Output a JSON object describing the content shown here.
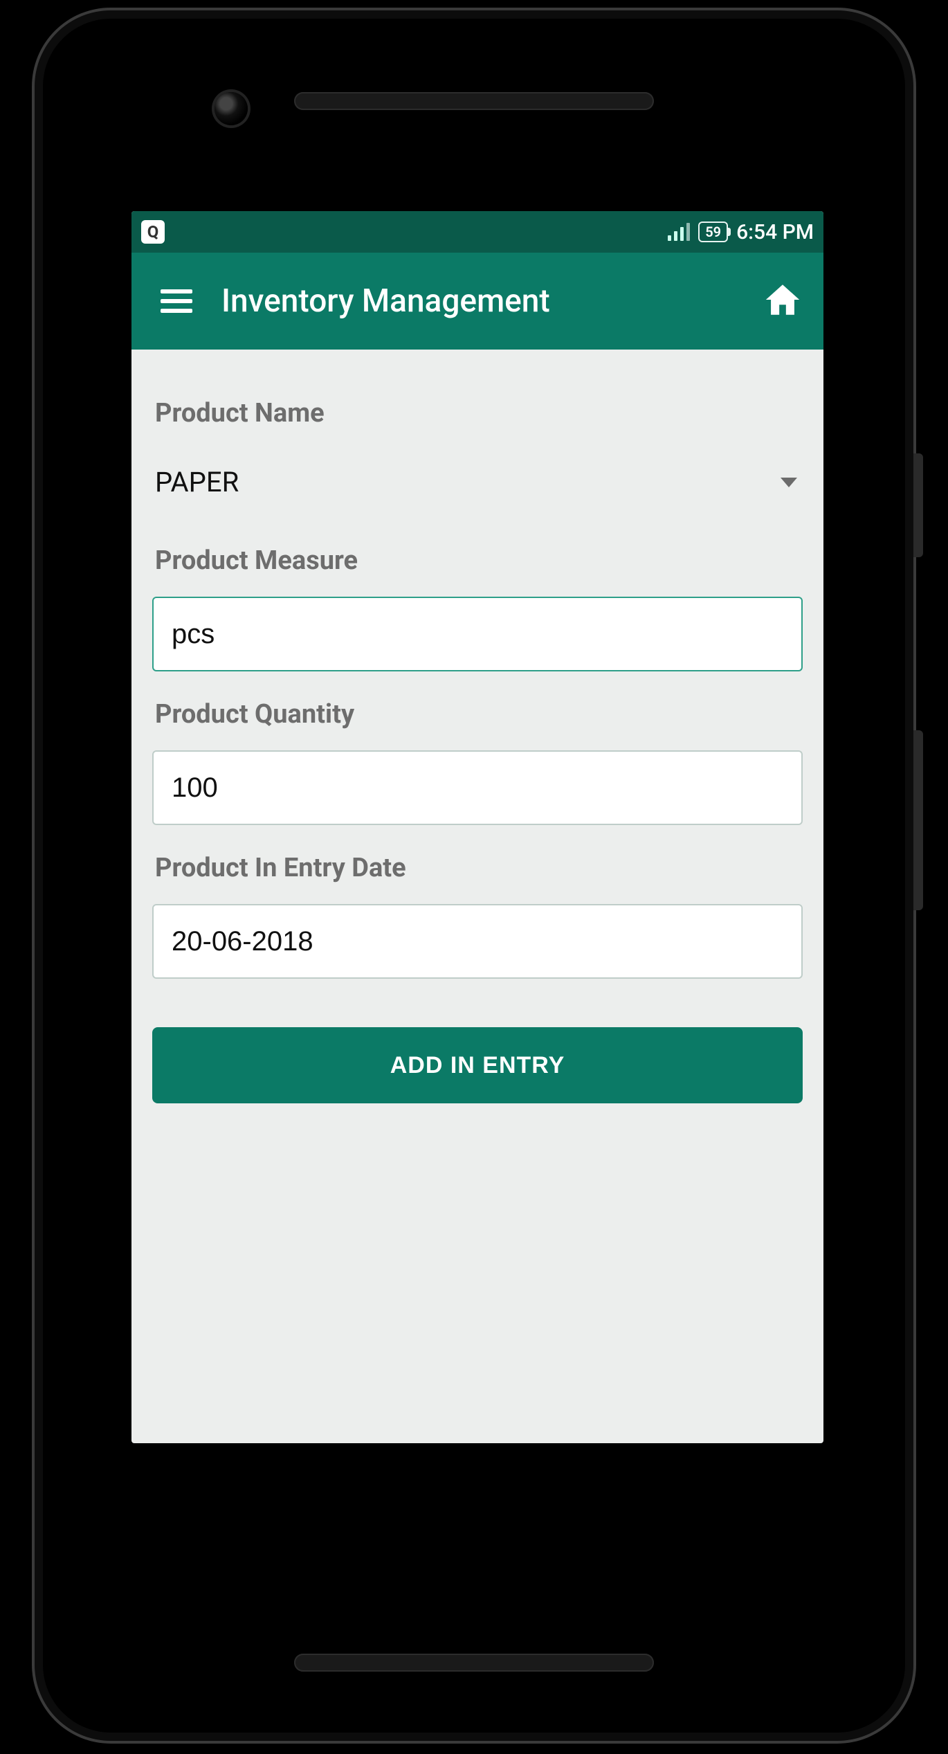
{
  "statusbar": {
    "notification_icon_label": "Q",
    "battery_pct": "59",
    "clock": "6:54 PM"
  },
  "appbar": {
    "title": "Inventory Management"
  },
  "form": {
    "product_name": {
      "label": "Product Name",
      "value": "PAPER"
    },
    "product_measure": {
      "label": "Product Measure",
      "value": "pcs"
    },
    "product_quantity": {
      "label": "Product Quantity",
      "value": "100"
    },
    "entry_date": {
      "label": "Product In Entry Date",
      "value": "20-06-2018"
    },
    "submit_label": "ADD IN ENTRY"
  }
}
